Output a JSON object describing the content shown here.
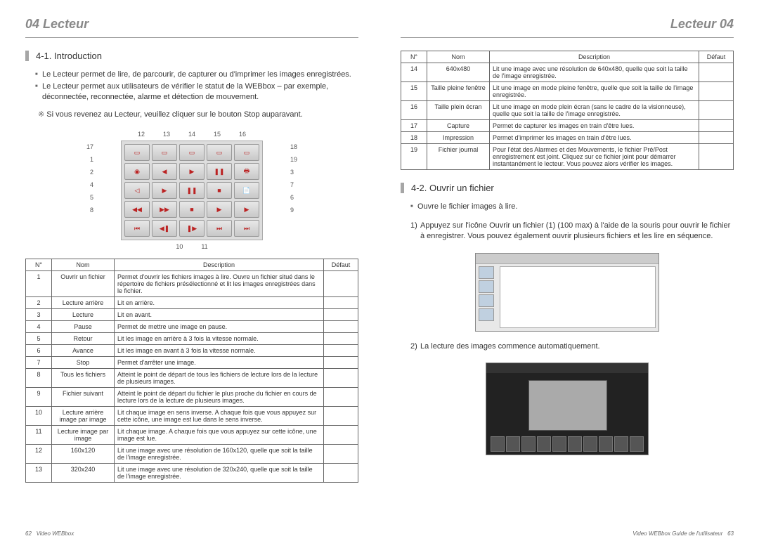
{
  "header": {
    "left_num": "04",
    "left_text": "Lecteur",
    "right_text": "Lecteur",
    "right_num": "04"
  },
  "section_intro": {
    "title": "4-1. Introduction",
    "bullets": [
      "Le Lecteur permet de lire, de parcourir, de capturer ou d'imprimer les images enregistrées.",
      "Le Lecteur permet aux utilisateurs de vérifier le statut de la WEBbox – par exemple, déconnectée, reconnectée, alarme et détection de mouvement."
    ],
    "note": "Si vous revenez au Lecteur, veuillez cliquer sur le bouton Stop auparavant."
  },
  "callouts_top": [
    "12",
    "13",
    "14",
    "15",
    "16"
  ],
  "callouts_leftcol": [
    "17",
    "1",
    "2",
    "4",
    "5",
    "8"
  ],
  "callouts_rightcol": [
    "18",
    "19",
    "3",
    "7",
    "6",
    "9"
  ],
  "callouts_bottom": [
    "10",
    "11"
  ],
  "table_headers": {
    "n": "N°",
    "nom": "Nom",
    "desc": "Description",
    "def": "Défaut"
  },
  "table1": [
    {
      "n": "1",
      "nom": "Ouvrir un fichier",
      "desc": "Permet d'ouvrir les fichiers images à lire. Ouvre un fichier situé dans le répertoire de fichiers présélectionné et lit les images enregistrées dans le fichier.",
      "def": ""
    },
    {
      "n": "2",
      "nom": "Lecture arrière",
      "desc": "Lit en arrière.",
      "def": ""
    },
    {
      "n": "3",
      "nom": "Lecture",
      "desc": "Lit en avant.",
      "def": ""
    },
    {
      "n": "4",
      "nom": "Pause",
      "desc": "Permet de mettre une image en pause.",
      "def": ""
    },
    {
      "n": "5",
      "nom": "Retour",
      "desc": "Lit les image en arrière à 3 fois la vitesse normale.",
      "def": ""
    },
    {
      "n": "6",
      "nom": "Avance",
      "desc": "Lit les image en avant à 3 fois la vitesse normale.",
      "def": ""
    },
    {
      "n": "7",
      "nom": "Stop",
      "desc": "Permet d'arrêter une image.",
      "def": ""
    },
    {
      "n": "8",
      "nom": "Tous les fichiers",
      "desc": "Atteint le point de départ de tous les fichiers de lecture lors de la lecture de plusieurs images.",
      "def": ""
    },
    {
      "n": "9",
      "nom": "Fichier suivant",
      "desc": "Atteint le point de départ du fichier le plus proche du fichier en cours de lecture lors de la lecture de plusieurs images.",
      "def": ""
    },
    {
      "n": "10",
      "nom": "Lecture arrière image par image",
      "desc": "Lit chaque image en sens inverse. A chaque fois que vous appuyez sur cette icône, une image est lue dans le sens inverse.",
      "def": ""
    },
    {
      "n": "11",
      "nom": "Lecture image par image",
      "desc": "Lit chaque image. A chaque fois que vous appuyez sur cette icône, une image est lue.",
      "def": ""
    },
    {
      "n": "12",
      "nom": "160x120",
      "desc": "Lit une image avec une résolution de 160x120, quelle que soit la taille de l'image enregistrée.",
      "def": ""
    },
    {
      "n": "13",
      "nom": "320x240",
      "desc": "Lit une image avec une résolution de 320x240, quelle que soit la taille de l'image enregistrée.",
      "def": ""
    }
  ],
  "table2": [
    {
      "n": "14",
      "nom": "640x480",
      "desc": "Lit une image avec une résolution de 640x480, quelle que soit la taille de l'image enregistrée.",
      "def": ""
    },
    {
      "n": "15",
      "nom": "Taille pleine fenêtre",
      "desc": "Lit une image en mode pleine fenêtre, quelle que soit la taille de l'image enregistrée.",
      "def": ""
    },
    {
      "n": "16",
      "nom": "Taille plein écran",
      "desc": "Lit une image en mode plein écran (sans le cadre de la visionneuse), quelle que soit la taille de l'image enregistrée.",
      "def": ""
    },
    {
      "n": "17",
      "nom": "Capture",
      "desc": "Permet de capturer les images en train d'être lues.",
      "def": ""
    },
    {
      "n": "18",
      "nom": "Impression",
      "desc": "Permet d'imprimer les images en train d'être lues.",
      "def": ""
    },
    {
      "n": "19",
      "nom": "Fichier journal",
      "desc": "Pour l'état des Alarmes et des Mouvements, le fichier Pré/Post enregistrement est joint. Cliquez sur ce fichier joint pour démarrer instantanément le lecteur. Vous pouvez alors vérifier les images.",
      "def": ""
    }
  ],
  "section_open": {
    "title": "4-2. Ouvrir un fichier",
    "bullets": [
      "Ouvre le fichier images à lire."
    ],
    "steps": [
      {
        "n": "1)",
        "text": "Appuyez sur l'icône Ouvrir un fichier (1) (100 max) à l'aide de la souris pour ouvrir le fichier à enregistrer. Vous pouvez également ouvrir plusieurs fichiers et les lire en séquence."
      },
      {
        "n": "2)",
        "text": "La lecture des images commence automatiquement."
      }
    ]
  },
  "footer": {
    "left_pg": "62",
    "left_txt": "Video WEBbox",
    "right_txt": "Video WEBbox Guide de l'utilisateur",
    "right_pg": "63"
  }
}
